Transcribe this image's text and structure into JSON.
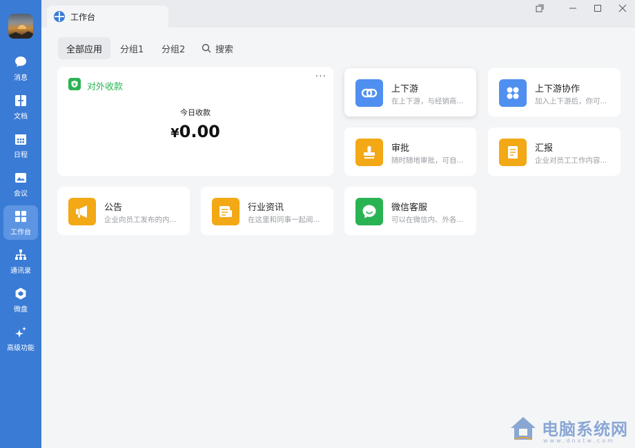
{
  "sidebar": {
    "items": [
      {
        "label": "消息",
        "icon": "chat-icon"
      },
      {
        "label": "文档",
        "icon": "document-icon"
      },
      {
        "label": "日程",
        "icon": "calendar-icon"
      },
      {
        "label": "会议",
        "icon": "meeting-icon"
      },
      {
        "label": "工作台",
        "icon": "workbench-icon",
        "active": true
      },
      {
        "label": "通讯录",
        "icon": "contacts-icon"
      },
      {
        "label": "微盘",
        "icon": "drive-icon"
      },
      {
        "label": "高级功能",
        "icon": "sparkle-icon"
      }
    ]
  },
  "titlebar": {
    "tab_label": "工作台"
  },
  "filters": {
    "all": "全部应用",
    "group1": "分组1",
    "group2": "分组2",
    "search": "搜索"
  },
  "payment_card": {
    "title": "对外收款",
    "more": "···",
    "today_label": "今日收款",
    "currency": "¥",
    "amount": "0.00"
  },
  "apps": [
    {
      "name": "上下游",
      "desc": "在上下游，与经销商...",
      "color": "#4f8ff0",
      "icon": "chain-link-icon"
    },
    {
      "name": "上下游协作",
      "desc": "加入上下游后，你可...",
      "color": "#4f8ff0",
      "icon": "grid-dots-icon"
    },
    {
      "name": "审批",
      "desc": "随时随地审批，可自...",
      "color": "#f3a816",
      "icon": "stamp-icon"
    },
    {
      "name": "汇报",
      "desc": "企业对员工工作内容...",
      "color": "#f3a816",
      "icon": "report-icon"
    },
    {
      "name": "公告",
      "desc": "企业向员工发布的内...",
      "color": "#f3a816",
      "icon": "megaphone-icon"
    },
    {
      "name": "行业资讯",
      "desc": "在这里和同事一起阅...",
      "color": "#f3a816",
      "icon": "news-icon"
    },
    {
      "name": "微信客服",
      "desc": "可以在微信内、外各...",
      "color": "#2ab353",
      "icon": "wechat-service-icon"
    }
  ],
  "watermark": {
    "text": "电脑系统网",
    "sub": "www.dnxtw.com"
  }
}
